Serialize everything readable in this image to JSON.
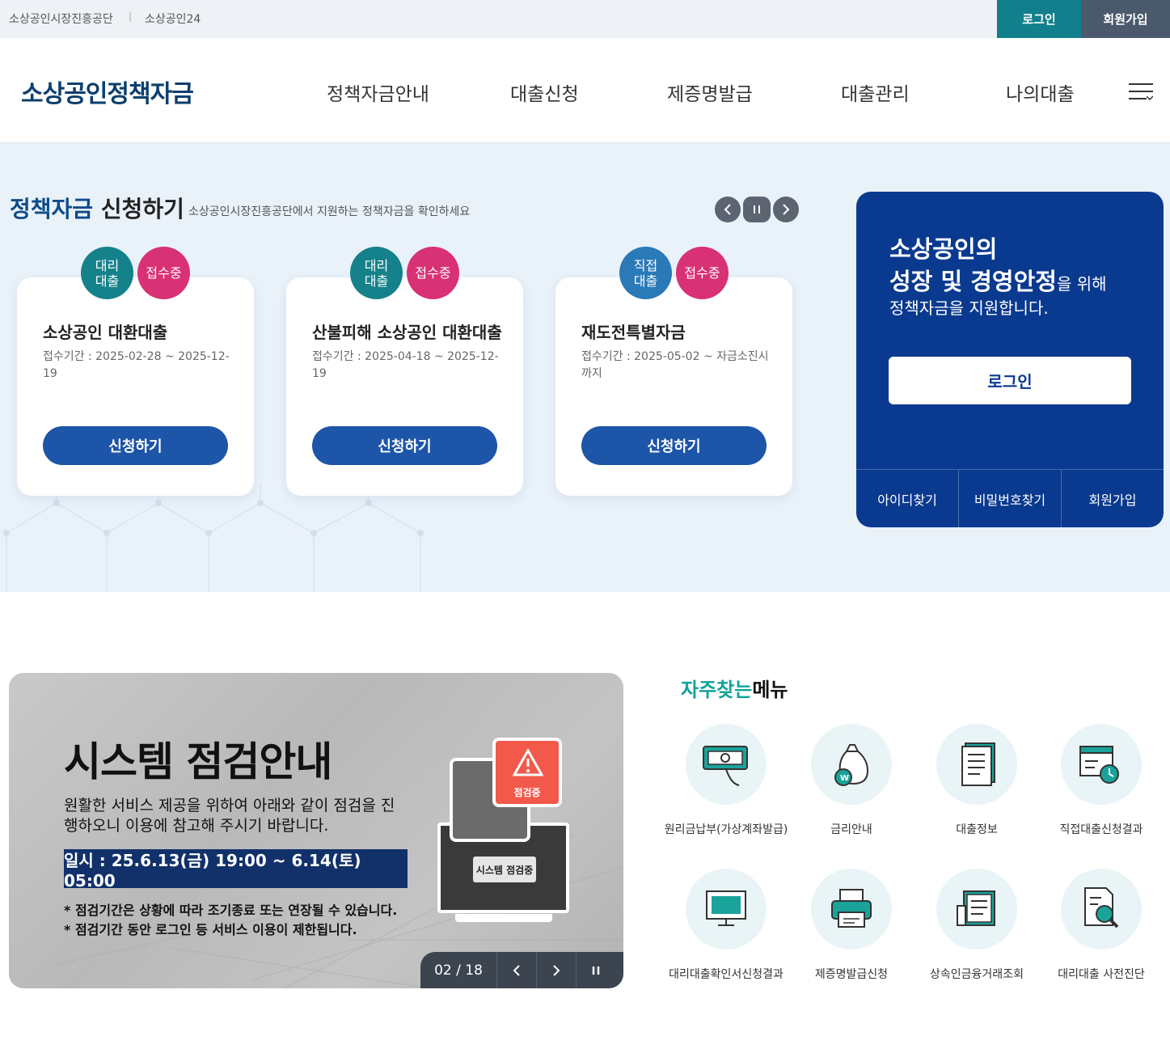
{
  "topbar": {
    "sites": [
      "소상공인시장진흥공단",
      "소상공인24"
    ],
    "login": "로그인",
    "join": "회원가입"
  },
  "header": {
    "logo": "소상공인정책자금",
    "nav": [
      "정책자금안내",
      "대출신청",
      "제증명발급",
      "대출관리",
      "나의대출"
    ]
  },
  "hero": {
    "title_a": "정책자금",
    "title_b": " 신청하기",
    "subtitle": "소상공인시장진흥공단에서 지원하는 정책자금을 확인하세요",
    "cards": [
      {
        "type": "대리\n대출",
        "status": "접수중",
        "name": "소상공인 대환대출",
        "period": "접수기간 : 2025-02-28 ~ 2025-12-19",
        "button": "신청하기"
      },
      {
        "type": "대리\n대출",
        "status": "접수중",
        "name": "산불피해 소상공인 대환대출",
        "period": "접수기간 : 2025-04-18 ~ 2025-12-19",
        "button": "신청하기"
      },
      {
        "type": "직접\n대출",
        "status": "접수중",
        "name": "재도전특별자금",
        "period": "접수기간 : 2025-05-02 ~ 자금소진시 까지",
        "button": "신청하기"
      }
    ]
  },
  "loginbox": {
    "line1": "소상공인의",
    "line2_bold": "성장 및 경영안정",
    "line2_rest": "을 위해",
    "line3": "정책자금을 지원합니다.",
    "button": "로그인",
    "links": [
      "아이디찾기",
      "비밀번호찾기",
      "회원가입"
    ]
  },
  "banner": {
    "title": "시스템 점검안내",
    "desc": "원활한 서비스 제공을 위하여 아래와 같이 점검을 진행하오니 이용에 참고해 주시기 바랍니다.",
    "date": "일시 : 25.6.13(금) 19:00 ~ 6.14(토) 05:00",
    "note1": "* 점검기간은 상황에 따라 조기종료 또는 연장될 수 있습니다.",
    "note2": "* 점검기간 동안 로그인 등 서비스 이용이 제한됩니다.",
    "badge": "점검중",
    "screen_label": "시스템 점검중",
    "page": "02 / 18"
  },
  "quick": {
    "title_a": "자주찾는",
    "title_b": "메뉴",
    "items": [
      {
        "label": "원리금납부(가상계좌발급)",
        "icon": "payment-icon"
      },
      {
        "label": "금리안내",
        "icon": "money-bag-icon"
      },
      {
        "label": "대출정보",
        "icon": "document-icon"
      },
      {
        "label": "직접대출신청결과",
        "icon": "calendar-clock-icon"
      },
      {
        "label": "대리대출확인서신청결과",
        "icon": "monitor-icon"
      },
      {
        "label": "제증명발급신청",
        "icon": "printer-icon"
      },
      {
        "label": "상속인금융거래조회",
        "icon": "newspaper-icon"
      },
      {
        "label": "대리대출 사전진단",
        "icon": "document-search-icon"
      }
    ]
  },
  "colors": {
    "navy": "#0a3a8f",
    "teal": "#15818a",
    "pink": "#d93175",
    "button_blue": "#1d55a8"
  }
}
